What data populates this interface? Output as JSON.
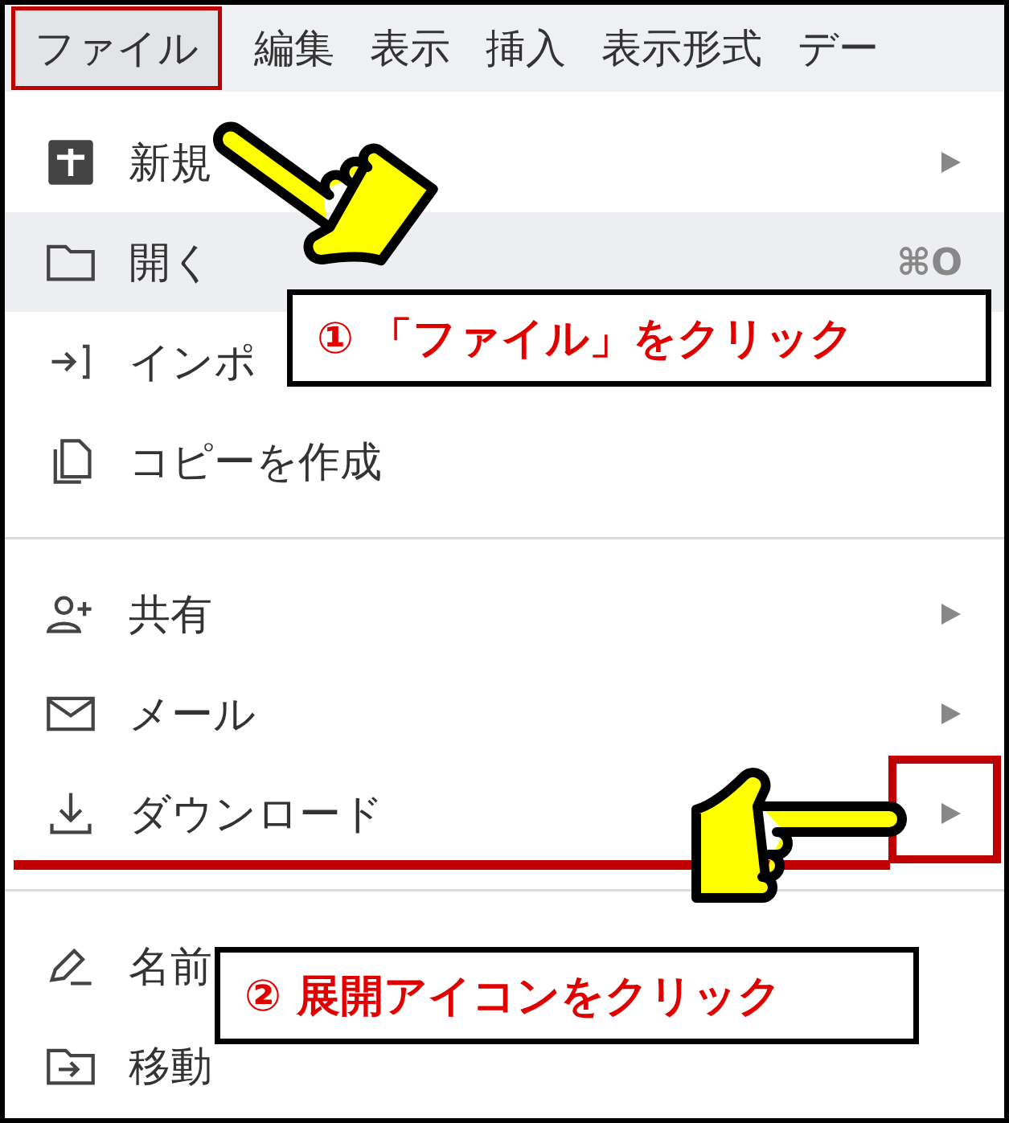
{
  "menu_bar": [
    {
      "label": "ファイル",
      "selected": true
    },
    {
      "label": "編集",
      "selected": false
    },
    {
      "label": "表示",
      "selected": false
    },
    {
      "label": "挿入",
      "selected": false
    },
    {
      "label": "表示形式",
      "selected": false
    },
    {
      "label": "デー",
      "selected": false
    }
  ],
  "menu_items": [
    {
      "kind": "item",
      "label": "新規",
      "hovered": false,
      "submenu": true,
      "marked": false
    },
    {
      "kind": "item",
      "label": "開く",
      "shortcut": "⌘O",
      "hovered": true,
      "submenu": false,
      "marked": false
    },
    {
      "kind": "item",
      "label": "インポ",
      "hovered": false,
      "submenu": false,
      "marked": false
    },
    {
      "kind": "item",
      "label": "コピーを作成",
      "hovered": false,
      "submenu": false,
      "marked": false
    },
    {
      "kind": "divider"
    },
    {
      "kind": "item",
      "label": "共有",
      "hovered": false,
      "submenu": true,
      "marked": false
    },
    {
      "kind": "item",
      "label": "メール",
      "hovered": false,
      "submenu": true,
      "marked": false
    },
    {
      "kind": "item",
      "label": "ダウンロード",
      "hovered": false,
      "submenu": true,
      "marked": true
    },
    {
      "kind": "divider"
    },
    {
      "kind": "item",
      "label": "名前",
      "hovered": false,
      "submenu": false,
      "marked": false
    },
    {
      "kind": "item",
      "label": "移動",
      "hovered": false,
      "submenu": false,
      "marked": false
    }
  ],
  "callouts": [
    {
      "text": "① 「ファイル」をクリック"
    },
    {
      "text": "② 展開アイコンをクリック"
    }
  ]
}
